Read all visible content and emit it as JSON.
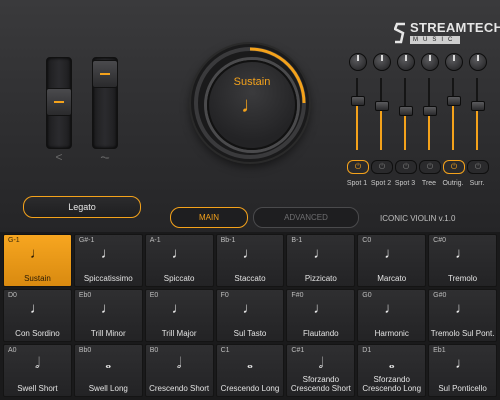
{
  "brand": {
    "name": "STREAMTECH",
    "sub": "MUSIC"
  },
  "mode_knob": {
    "label": "Sustain",
    "note": "♩"
  },
  "left_faders": [
    {
      "icon": "<"
    },
    {
      "icon": "⏦"
    }
  ],
  "mixer": {
    "channels": [
      {
        "label": "Spot 1",
        "level": 0.7,
        "active": true
      },
      {
        "label": "Spot 2",
        "level": 0.62,
        "active": false
      },
      {
        "label": "Spot 3",
        "level": 0.55,
        "active": false
      },
      {
        "label": "Tree",
        "level": 0.55,
        "active": false
      },
      {
        "label": "Outrig.",
        "level": 0.7,
        "active": true
      },
      {
        "label": "Surr.",
        "level": 0.62,
        "active": false
      }
    ]
  },
  "legato_label": "Legato",
  "tabs": {
    "main": "MAIN",
    "advanced": "ADVANCED"
  },
  "version": "ICONIC VIOLIN v.1.0",
  "articulations": [
    {
      "key": "G-1",
      "name": "Sustain",
      "sym": "♩",
      "active": true
    },
    {
      "key": "G#-1",
      "name": "Spiccatissimo",
      "sym": "♩",
      "active": false
    },
    {
      "key": "A-1",
      "name": "Spiccato",
      "sym": "♩",
      "active": false
    },
    {
      "key": "Bb-1",
      "name": "Staccato",
      "sym": "♩",
      "active": false
    },
    {
      "key": "B-1",
      "name": "Pizzicato",
      "sym": "♩",
      "active": false
    },
    {
      "key": "C0",
      "name": "Marcato",
      "sym": "♩",
      "active": false
    },
    {
      "key": "C#0",
      "name": "Tremolo",
      "sym": "♩",
      "active": false
    },
    {
      "key": "D0",
      "name": "Con Sordino",
      "sym": "♩",
      "active": false
    },
    {
      "key": "Eb0",
      "name": "Trill Minor",
      "sym": "♩",
      "active": false
    },
    {
      "key": "E0",
      "name": "Trill Major",
      "sym": "♩",
      "active": false
    },
    {
      "key": "F0",
      "name": "Sul Tasto",
      "sym": "♩",
      "active": false
    },
    {
      "key": "F#0",
      "name": "Flautando",
      "sym": "♩",
      "active": false
    },
    {
      "key": "G0",
      "name": "Harmonic",
      "sym": "♩",
      "active": false
    },
    {
      "key": "G#0",
      "name": "Tremolo Sul Pont.",
      "sym": "♩",
      "active": false
    },
    {
      "key": "A0",
      "name": "Swell Short",
      "sym": "𝅗𝅥",
      "active": false
    },
    {
      "key": "Bb0",
      "name": "Swell Long",
      "sym": "𝅝",
      "active": false
    },
    {
      "key": "B0",
      "name": "Crescendo Short",
      "sym": "𝅗𝅥",
      "active": false
    },
    {
      "key": "C1",
      "name": "Crescendo Long",
      "sym": "𝅝",
      "active": false
    },
    {
      "key": "C#1",
      "name": "Sforzando Crescendo Short",
      "sym": "𝅗𝅥",
      "active": false
    },
    {
      "key": "D1",
      "name": "Sforzando Crescendo Long",
      "sym": "𝅝",
      "active": false
    },
    {
      "key": "Eb1",
      "name": "Sul Ponticello",
      "sym": "♩",
      "active": false
    }
  ],
  "colors": {
    "accent": "#f4a21b",
    "panel": "#2d2d2f"
  }
}
